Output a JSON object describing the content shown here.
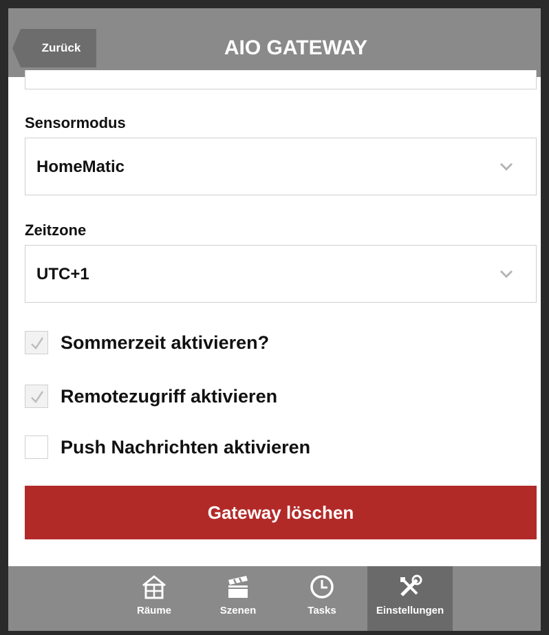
{
  "header": {
    "back_label": "Zurück",
    "title": "AIO GATEWAY"
  },
  "sensor": {
    "label": "Sensormodus",
    "value": "HomeMatic",
    "icon": "chevron-down-icon"
  },
  "timezone": {
    "label": "Zeitzone",
    "value": "UTC+1",
    "icon": "chevron-down-icon"
  },
  "options": [
    {
      "label": "Sommerzeit aktivieren?",
      "checked": true
    },
    {
      "label": "Remotezugriff aktivieren",
      "checked": true
    },
    {
      "label": "Push Nachrichten aktivieren",
      "checked": false
    }
  ],
  "delete_button": {
    "label": "Gateway löschen",
    "color": "#b22a28"
  },
  "tabs": [
    {
      "label": "Räume",
      "icon": "house-icon",
      "active": false
    },
    {
      "label": "Szenen",
      "icon": "clapperboard-icon",
      "active": false
    },
    {
      "label": "Tasks",
      "icon": "clock-icon",
      "active": false
    },
    {
      "label": "Einstellungen",
      "icon": "tools-icon",
      "active": true
    }
  ]
}
